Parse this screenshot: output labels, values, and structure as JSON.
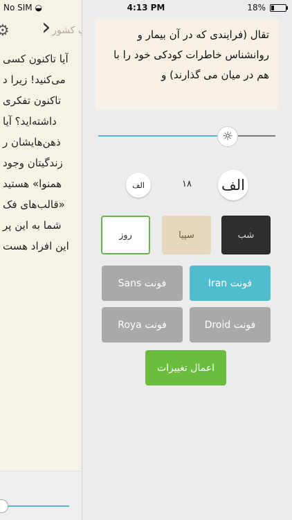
{
  "status_bar": {
    "carrier": "No SIM",
    "time": "4:13 PM",
    "battery": "18%",
    "battery_level": 0.18
  },
  "reader": {
    "title": "اطرافِ کشور",
    "lines": [
      "آیا تاکنون کسی",
      "می‌کنید! زیرا د",
      "تاکنون تفکری",
      "داشته‌اید؟ آیا",
      "ذهن‌هایشان ر",
      "زندگیتان وجود",
      "همنوا» هستید",
      "«قالب‌های فک",
      "شما به این پر",
      "این افراد هست"
    ],
    "progress": 0.0
  },
  "settings": {
    "preview_text": "تقال (فرایندی که در آن بیمار و روانشناس خاطرات کودکی خود را با هم در میان می گذارند) و",
    "brightness": 0.7,
    "font_size": {
      "small_label": "الف",
      "value": "۱۸",
      "large_label": "الف"
    },
    "themes": {
      "day": "روز",
      "sepia": "سپیا",
      "night": "شب",
      "selected": "day"
    },
    "fonts": {
      "sans": "فونت Sans",
      "iran": "فونت Iran",
      "roya": "فونت Roya",
      "droid": "فونت Droid",
      "selected": "iran"
    },
    "apply_label": "اعمال تغییرات"
  },
  "colors": {
    "accent": "#4fbdcd",
    "apply": "#6bbd3d",
    "selected_border": "#6ab04c"
  }
}
